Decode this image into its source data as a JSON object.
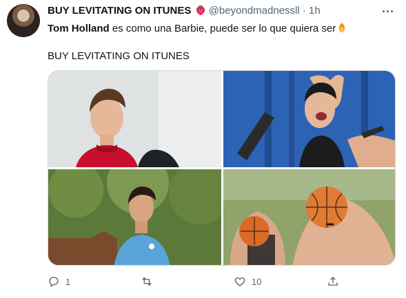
{
  "tweet": {
    "display_name": "BUY LEVITATING ON ITUNES",
    "handle": "@beyondmadnessll",
    "separator": "·",
    "time": "1h",
    "line1_bold": "Tom Holland",
    "line1_rest": " es como una Barbie, puede ser lo que quiera ser",
    "line2": "BUY LEVITATING ON ITUNES"
  },
  "actions": {
    "reply_count": "1",
    "retweet_count": "",
    "like_count": "10"
  },
  "colors": {
    "text": "#0f1419",
    "muted": "#536471",
    "border": "#cfd9de"
  },
  "icons": {
    "badge": "strawberry-icon",
    "flame": "fire-icon",
    "reply": "reply-icon",
    "retweet": "retweet-icon",
    "like": "heart-icon",
    "share": "share-icon",
    "more": "more-icon"
  }
}
